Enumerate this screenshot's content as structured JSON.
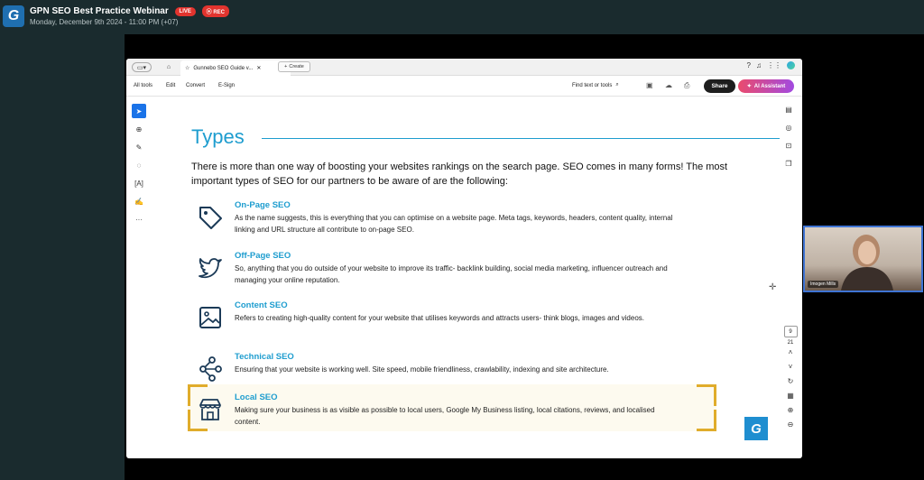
{
  "webinar": {
    "logo": "G",
    "title": "GPN SEO Best Practice Webinar",
    "live_badge": "LIVE",
    "rec_badge": "⦿ REC",
    "datetime": "Monday, December 9th 2024 - 11:00 PM (+07)"
  },
  "browser": {
    "tab_title": "Gunnebo SEO Guide v...",
    "create_label": "Create"
  },
  "menu": {
    "items": [
      "All tools",
      "Edit",
      "Convert",
      "E-Sign"
    ],
    "find_label": "Find text or tools",
    "share_label": "Share",
    "ai_label": "AI Assistant"
  },
  "pager": {
    "current": "9",
    "total": "21"
  },
  "content": {
    "title": "Types",
    "intro": "There is more than one way of boosting your websites rankings on the search page. SEO comes in many forms! The most important types of SEO for our partners to be aware of are the following:",
    "items": [
      {
        "heading": "On-Page SEO",
        "body": "As the name suggests, this is everything that you can optimise on a website page. Meta tags, keywords, headers, content quality, internal linking and URL structure all contribute to on-page SEO."
      },
      {
        "heading": "Off-Page SEO",
        "body": "So, anything that you do outside of your website to improve its traffic- backlink building, social media marketing, influencer outreach and managing your online reputation."
      },
      {
        "heading": "Content SEO",
        "body": "Refers to creating high-quality content for your website that utilises keywords and attracts users- think blogs, images and videos."
      },
      {
        "heading": "Technical SEO",
        "body": "Ensuring that your website is working well. Site speed, mobile friendliness, crawlability, indexing and site architecture."
      },
      {
        "heading": "Local SEO",
        "body": "Making sure your business is as visible as possible to local users, Google My Business listing, local citations, reviews, and localised content."
      }
    ],
    "page_logo": "G"
  },
  "webcam": {
    "name": "Imogen Mills"
  },
  "colors": {
    "accent": "#1e9dcf",
    "highlight_bracket": "#e0ac2b",
    "live": "#e2342e"
  },
  "icons": [
    "home-icon",
    "star-icon",
    "help-icon",
    "bell-icon",
    "apps-icon",
    "search-icon",
    "save-icon",
    "upload-icon",
    "print-icon",
    "tag-icon",
    "twitter-icon",
    "image-icon",
    "network-icon",
    "storefront-icon"
  ]
}
